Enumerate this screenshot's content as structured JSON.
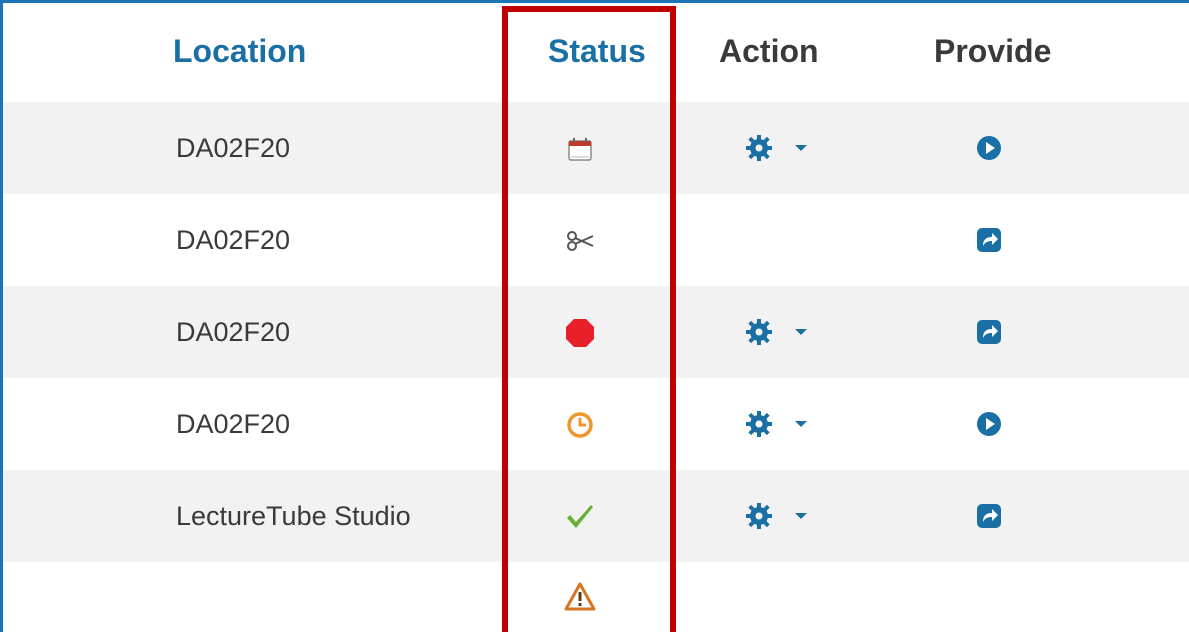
{
  "header": {
    "location": "Location",
    "status": "Status",
    "action": "Action",
    "provide": "Provide"
  },
  "rows": [
    {
      "location": "DA02F20",
      "status_icon": "calendar-icon",
      "action_icon": "gear-dropdown-icon",
      "provide_icon": "play-circle-icon"
    },
    {
      "location": "DA02F20",
      "status_icon": "scissors-icon",
      "action_icon": "",
      "provide_icon": "share-square-icon"
    },
    {
      "location": "DA02F20",
      "status_icon": "stop-octagon-icon",
      "action_icon": "gear-dropdown-icon",
      "provide_icon": "share-square-icon"
    },
    {
      "location": "DA02F20",
      "status_icon": "clock-icon",
      "action_icon": "gear-dropdown-icon",
      "provide_icon": "play-circle-icon"
    },
    {
      "location": "LectureTube Studio",
      "status_icon": "checkmark-icon",
      "action_icon": "gear-dropdown-icon",
      "provide_icon": "share-square-icon"
    },
    {
      "location": "",
      "status_icon": "warning-triangle-icon",
      "action_icon": "",
      "provide_icon": ""
    }
  ],
  "colors": {
    "header_link": "#1a6fa5",
    "header_text": "#3a3a3a",
    "icon_blue": "#1a6fa5",
    "highlight_red": "#c00000",
    "row_shade": "#f2f2f2",
    "stop_red": "#e8202a",
    "clock_orange": "#f0962a",
    "check_green": "#66b032",
    "warning_orange": "#d9731f"
  }
}
